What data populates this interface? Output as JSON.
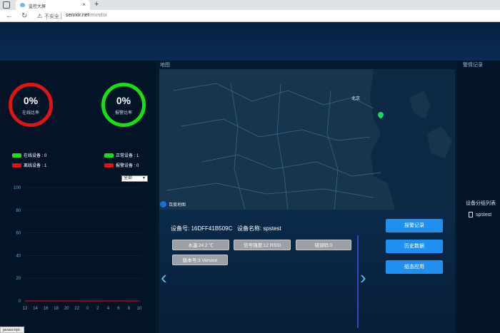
{
  "browser": {
    "tab_title": "监控大屏",
    "new_tab": "+",
    "insecure_label": "不安全",
    "url_host": "sennor.net",
    "url_path": "/monitor"
  },
  "stats": {
    "online_pct": "0%",
    "online_label": "在线比率",
    "alarm_pct": "0%",
    "alarm_label": "报警比率",
    "colors": {
      "online_ring": "#e01414",
      "alarm_ring": "#16e016"
    }
  },
  "legend": {
    "online": "在线设备 : 0",
    "offline": "离线设备 : 1",
    "normal": "正常设备 : 1",
    "alarm": "报警设备 : 0",
    "colors": {
      "green": "#16e016",
      "red": "#e01414"
    }
  },
  "filter": {
    "selected": "全部"
  },
  "chart_data": {
    "type": "line",
    "x": [
      "12",
      "14",
      "16",
      "18",
      "20",
      "22",
      "0",
      "2",
      "4",
      "6",
      "8",
      "10"
    ],
    "yticks": [
      "100",
      "80",
      "60",
      "40",
      "20",
      "0"
    ],
    "ylim": [
      0,
      100
    ],
    "series": [
      {
        "values": [
          0,
          0,
          0,
          0,
          0,
          0,
          0,
          0,
          0,
          0,
          0,
          0
        ]
      }
    ]
  },
  "map": {
    "section_title": "地图",
    "city_label": "北京",
    "attribution": "百度地图"
  },
  "device": {
    "id_label": "设备号:",
    "id_value": "16DFF41B509C",
    "name_label": "设备名称:",
    "name_value": "spstest",
    "chips": {
      "water_temp": "水温:24.2 ℃",
      "signal": "信号强度:12 RSSI",
      "error": "错误码:0",
      "version": "版本号:3 Version"
    },
    "prev": "‹",
    "next": "›"
  },
  "actions": {
    "alarm_record": "报警记录",
    "history": "历史数据",
    "config": "组态应用"
  },
  "sidebar": {
    "alarm_title": "警情记录",
    "group_title": "设备分组列表",
    "group_item": "spstest"
  },
  "statusbar": {
    "text": "javascript:;"
  }
}
